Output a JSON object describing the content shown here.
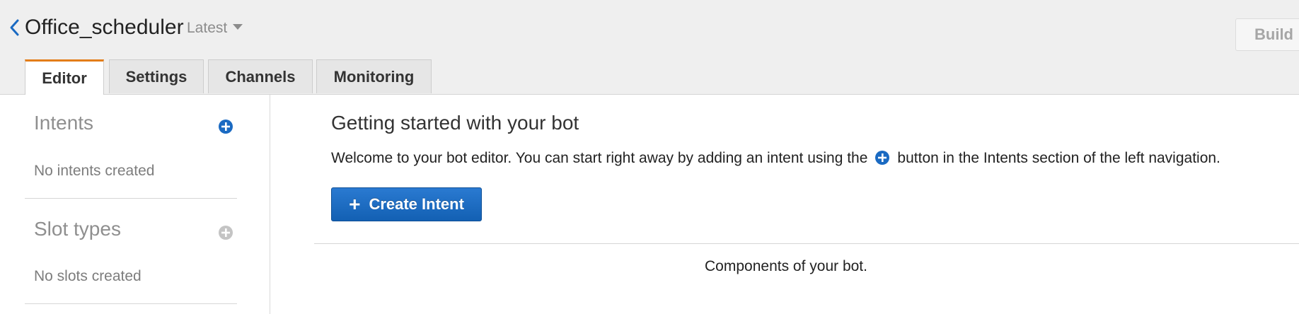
{
  "header": {
    "bot_name": "Office_scheduler",
    "version": "Latest",
    "build_label": "Build"
  },
  "tabs": [
    {
      "label": "Editor",
      "active": true
    },
    {
      "label": "Settings",
      "active": false
    },
    {
      "label": "Channels",
      "active": false
    },
    {
      "label": "Monitoring",
      "active": false
    }
  ],
  "sidebar": {
    "intents": {
      "title": "Intents",
      "empty_text": "No intents created"
    },
    "slot_types": {
      "title": "Slot types",
      "empty_text": "No slots created"
    }
  },
  "main": {
    "title": "Getting started with your bot",
    "desc_before": "Welcome to your bot editor. You can start right away by adding an intent using the",
    "desc_after": "button in the Intents section of the left navigation.",
    "create_button_label": "Create Intent",
    "components_text": "Components of your bot."
  },
  "colors": {
    "accent_tab": "#e37d19",
    "primary_button": "#1a6ac2",
    "add_icon": "#1a6ac2",
    "disabled_add_icon": "#c4c4c4"
  },
  "icons": {
    "back": "chevron-left-icon",
    "version_dropdown": "caret-down-icon",
    "add_intent": "plus-circle-icon",
    "add_slot_type": "plus-circle-icon",
    "inline_add": "plus-circle-icon"
  }
}
